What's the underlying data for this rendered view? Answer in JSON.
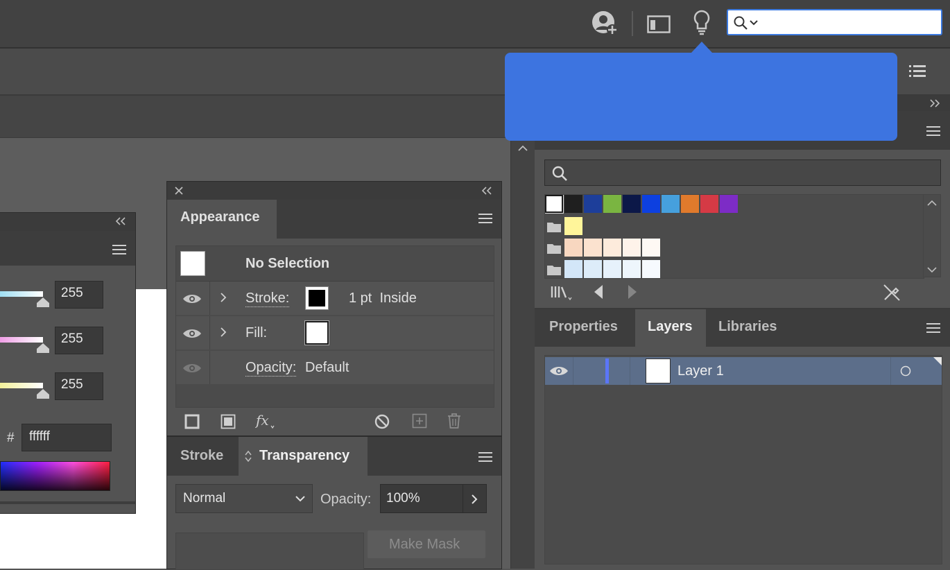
{
  "colors": {
    "accent": "#3d74e0",
    "layer_highlight": "#5c6e8a",
    "layer_color_bar": "#5b76f7"
  },
  "topbar": {
    "icons": [
      "user-add-icon",
      "workspace-icon",
      "lightbulb-icon",
      "search-icon"
    ],
    "search_value": ""
  },
  "color_panel": {
    "r_value": "255",
    "g_value": "255",
    "b_value": "255",
    "hex_label": "#",
    "hex_value": "ffffff"
  },
  "appearance_panel": {
    "tab_label": "Appearance",
    "selection_label": "No Selection",
    "stroke_label": "Stroke:",
    "stroke_value": "1 pt  Inside",
    "fill_label": "Fill:",
    "opacity_label": "Opacity:",
    "opacity_value": "Default"
  },
  "transparency_panel": {
    "tabs": [
      "Stroke",
      "Transparency"
    ],
    "active_tab": "Transparency",
    "blend_mode": "Normal",
    "opacity_label": "Opacity:",
    "opacity_value": "100%",
    "make_mask_label": "Make Mask"
  },
  "swatches_panel": {
    "search_value": "",
    "row1": [
      "#ffffff",
      "#1f1f1f",
      "#1d3e9a",
      "#7ab541",
      "#0c1848",
      "#0d40e0",
      "#46a0dd",
      "#e07a2c",
      "#d53a45",
      "#7d2cc6"
    ],
    "group1": [
      "#fff59a"
    ],
    "group2": [
      "#f8d7c0",
      "#fbe2cf",
      "#fdebdc",
      "#fef3ea",
      "#fef9f4"
    ],
    "group3": [
      "#d3e6f8",
      "#ddecf9",
      "#e6f1fb",
      "#eef6fc",
      "#f6fafe"
    ]
  },
  "right_tabs": {
    "tabs": [
      "Properties",
      "Layers",
      "Libraries"
    ],
    "active": "Layers"
  },
  "layers": [
    {
      "name": "Layer 1",
      "visible": true
    }
  ]
}
